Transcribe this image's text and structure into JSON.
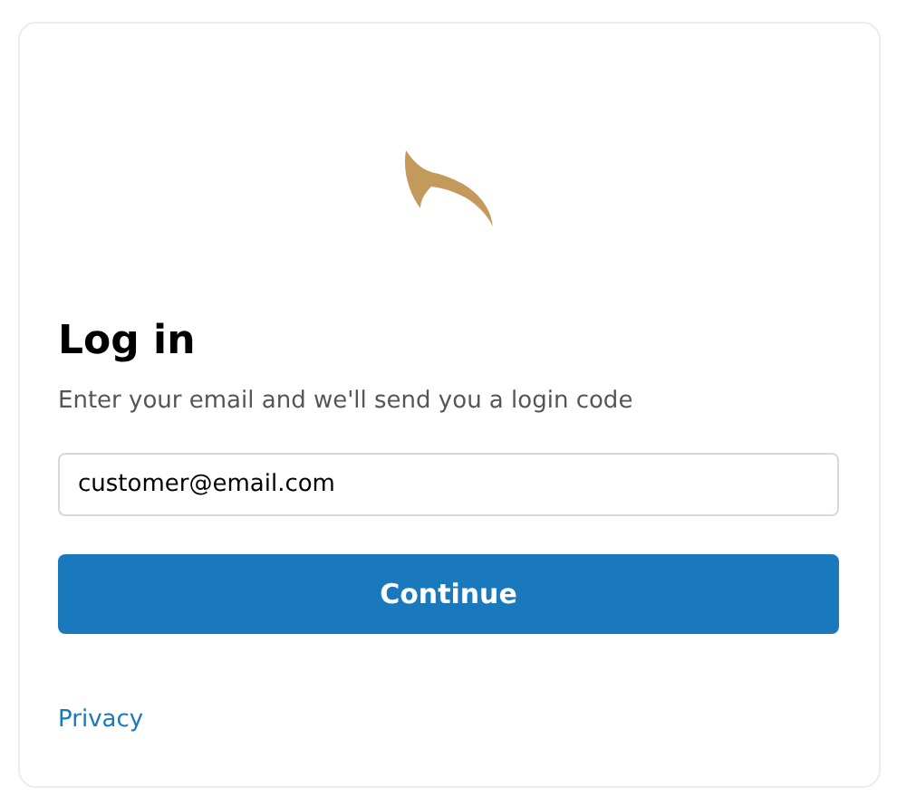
{
  "title": "Log in",
  "subtitle": "Enter your email and we'll send you a login code",
  "email": {
    "value": "customer@email.com"
  },
  "button": "Continue",
  "footer_link": "Privacy"
}
